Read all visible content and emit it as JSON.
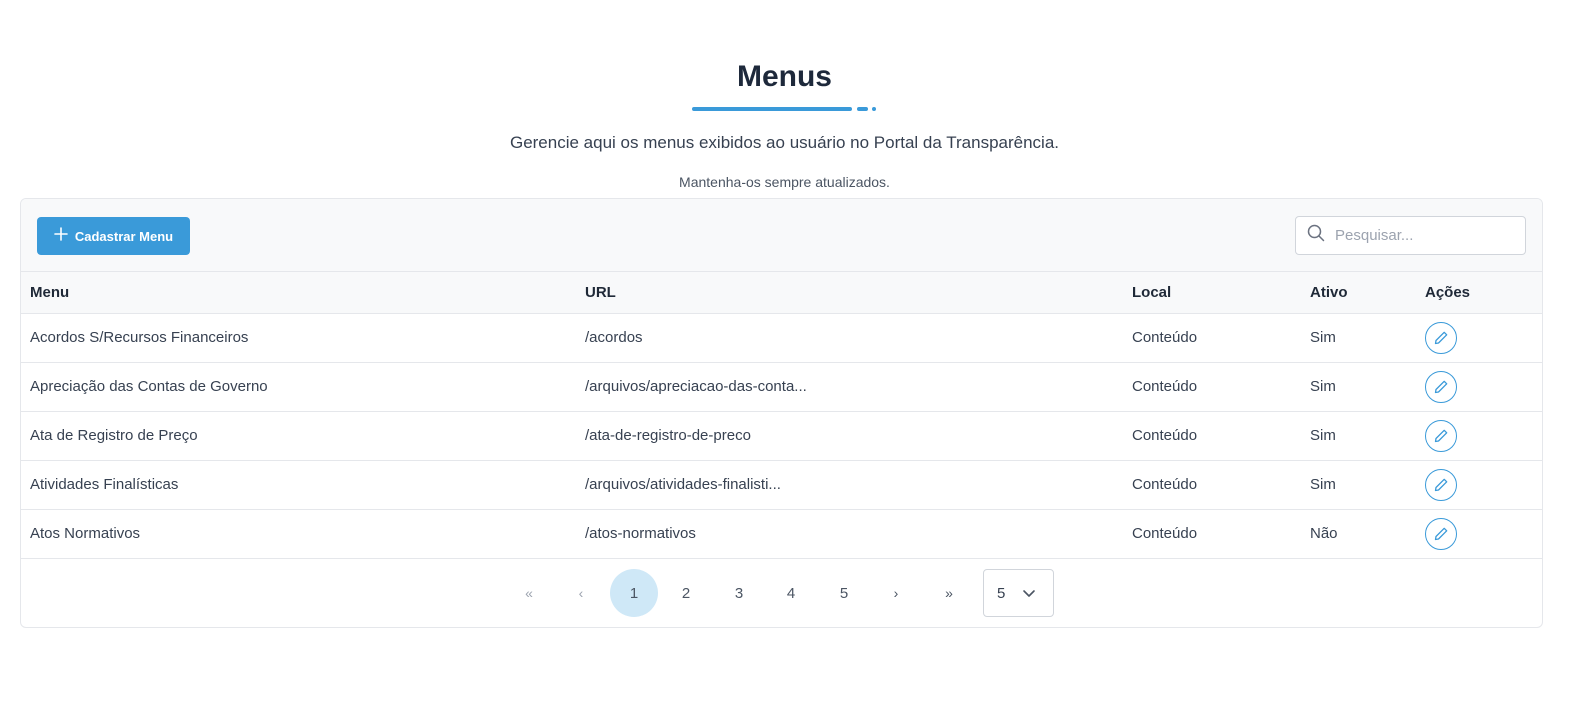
{
  "header": {
    "title": "Menus",
    "subtitle": "Gerencie aqui os menus exibidos ao usuário no Portal da Transparência.",
    "note": "Mantenha-os sempre atualizados."
  },
  "toolbar": {
    "add_label": "Cadastrar Menu",
    "search_placeholder": "Pesquisar..."
  },
  "table": {
    "columns": [
      "Menu",
      "URL",
      "Local",
      "Ativo",
      "Ações"
    ],
    "rows": [
      {
        "menu": "Acordos S/Recursos Financeiros",
        "url": "/acordos",
        "local": "Conteúdo",
        "ativo": "Sim"
      },
      {
        "menu": "Apreciação das Contas de Governo",
        "url": "/arquivos/apreciacao-das-conta...",
        "local": "Conteúdo",
        "ativo": "Sim"
      },
      {
        "menu": "Ata de Registro de Preço",
        "url": "/ata-de-registro-de-preco",
        "local": "Conteúdo",
        "ativo": "Sim"
      },
      {
        "menu": "Atividades Finalísticas",
        "url": "/arquivos/atividades-finalisti...",
        "local": "Conteúdo",
        "ativo": "Sim"
      },
      {
        "menu": "Atos Normativos",
        "url": "/atos-normativos",
        "local": "Conteúdo",
        "ativo": "Não"
      }
    ]
  },
  "pagination": {
    "first": "«",
    "prev": "‹",
    "pages": [
      "1",
      "2",
      "3",
      "4",
      "5"
    ],
    "current": "1",
    "next": "›",
    "last": "»",
    "rows_per_page": "5"
  },
  "icons": {
    "add": "plus-icon",
    "search": "search-icon",
    "edit": "pencil-icon",
    "select": "chevron-down-icon"
  },
  "colors": {
    "accent": "#3a9ad9",
    "active_page_bg": "#cfe8f7",
    "toolbar_bg": "#f8f9fa"
  }
}
